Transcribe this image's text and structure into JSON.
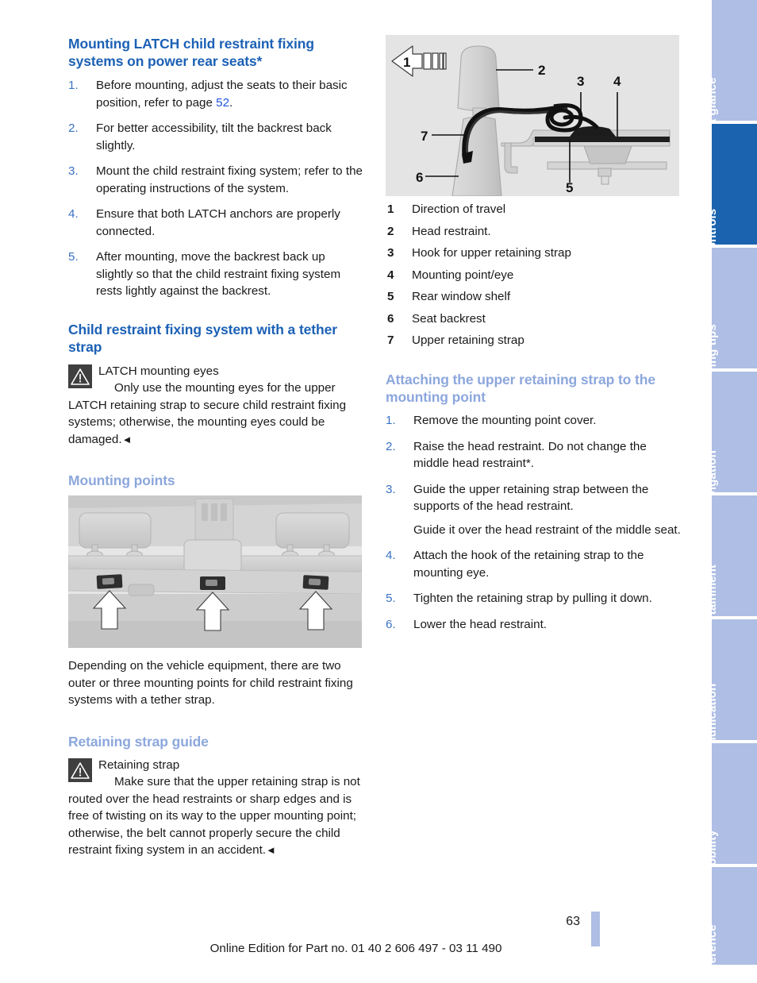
{
  "document": {
    "page_number": "63",
    "footer_note": "Online Edition for Part no. 01 40 2 606 497 - 03 11 490"
  },
  "colors": {
    "heading_primary": "#1c61b5",
    "heading_secondary": "#8ca7dd",
    "list_number": "#3a73c4",
    "cross_reference": "#2255dd",
    "tab_active": "#1b63ae",
    "tab_inactive": "#aebee4",
    "warning_box": "#3f3f3f",
    "figure_background": "#e2e2e2"
  },
  "left_column": {
    "section1": {
      "heading": "Mounting LATCH child restraint fixing systems on power rear seats*",
      "steps": [
        {
          "num": "1.",
          "text_before": "Before mounting, adjust the seats to their basic position, refer to page ",
          "xref": "52",
          "text_after": "."
        },
        {
          "num": "2.",
          "text": "For better accessibility, tilt the backrest back slightly."
        },
        {
          "num": "3.",
          "text": "Mount the child restraint fixing system; refer to the operating instructions of the system."
        },
        {
          "num": "4.",
          "text": "Ensure that both LATCH anchors are properly connected."
        },
        {
          "num": "5.",
          "text": "After mounting, move the backrest back up slightly so that the child restraint fixing system rests lightly against the backrest."
        }
      ]
    },
    "section2": {
      "heading": "Child restraint fixing system with a tether strap",
      "warning": {
        "icon": "warning-triangle-icon",
        "title": "LATCH mounting eyes",
        "body": "Only use the mounting eyes for the upper LATCH retaining strap to secure child restraint fixing systems; otherwise, the mounting eyes could be damaged.",
        "endmark": "◄"
      }
    },
    "section3": {
      "heading": "Mounting points",
      "figure_alt": "Rear parcel shelf showing three tether mounting points with arrows",
      "paragraph": "Depending on the vehicle equipment, there are two outer or three mounting points for child restraint fixing systems with a tether strap."
    },
    "section4": {
      "heading": "Retaining strap guide",
      "warning": {
        "icon": "warning-triangle-icon",
        "title": "Retaining strap",
        "body": "Make sure that the upper retaining strap is not routed over the head restraints or sharp edges and is free of twisting on its way to the upper mounting point; otherwise, the belt cannot properly secure the child restraint fixing system in an accident.",
        "endmark": "◄"
      }
    }
  },
  "right_column": {
    "figure": {
      "alt": "Side view diagram of seat backrest, head restraint and upper retaining strap routed to the mounting point on the rear window shelf",
      "callouts": [
        "1",
        "2",
        "3",
        "4",
        "5",
        "6",
        "7"
      ]
    },
    "legend": [
      {
        "num": "1",
        "label": "Direction of travel"
      },
      {
        "num": "2",
        "label": "Head restraint."
      },
      {
        "num": "3",
        "label": "Hook for upper retaining strap"
      },
      {
        "num": "4",
        "label": "Mounting point/eye"
      },
      {
        "num": "5",
        "label": "Rear window shelf"
      },
      {
        "num": "6",
        "label": "Seat backrest"
      },
      {
        "num": "7",
        "label": "Upper retaining strap"
      }
    ],
    "section": {
      "heading": "Attaching the upper retaining strap to the mounting point",
      "steps": [
        {
          "num": "1.",
          "text": "Remove the mounting point cover."
        },
        {
          "num": "2.",
          "text": "Raise the head restraint. Do not change the middle head restraint*."
        },
        {
          "num": "3.",
          "text": "Guide the upper retaining strap between the supports of the head restraint."
        },
        {
          "num": "",
          "text": "Guide it over the head restraint of the middle seat."
        },
        {
          "num": "4.",
          "text": "Attach the hook of the retaining strap to the mounting eye."
        },
        {
          "num": "5.",
          "text": "Tighten the retaining strap by pulling it down."
        },
        {
          "num": "6.",
          "text": "Lower the head restraint."
        }
      ]
    }
  },
  "tabs": [
    {
      "label": "At a glance",
      "active": false
    },
    {
      "label": "Controls",
      "active": true
    },
    {
      "label": "Driving tips",
      "active": false
    },
    {
      "label": "Navigation",
      "active": false
    },
    {
      "label": "Entertainment",
      "active": false
    },
    {
      "label": "Communication",
      "active": false
    },
    {
      "label": "Mobility",
      "active": false
    },
    {
      "label": "Reference",
      "active": false
    }
  ]
}
